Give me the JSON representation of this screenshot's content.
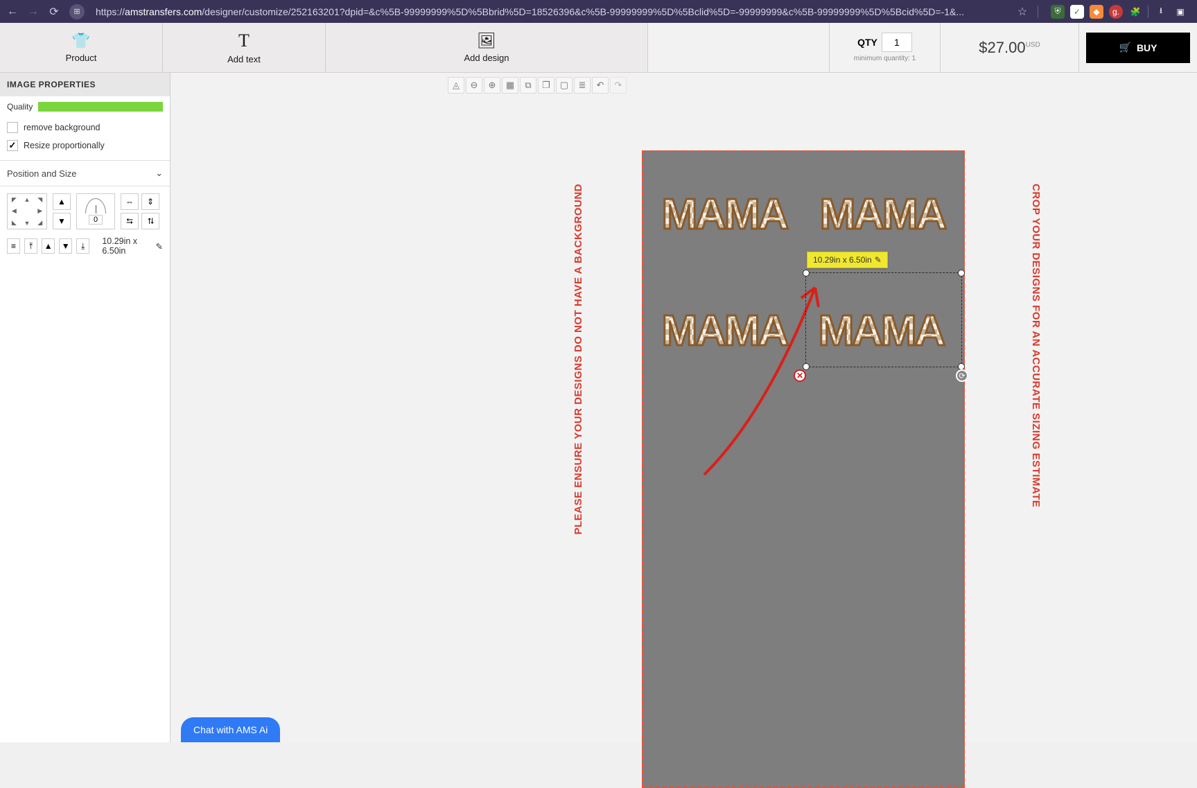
{
  "browser": {
    "url_prefix": "https://",
    "url_domain": "amstransfers.com",
    "url_path": "/designer/customize/252163201?dpid=&c%5B-99999999%5D%5Bbrid%5D=18526396&c%5B-99999999%5D%5Bclid%5D=-99999999&c%5B-99999999%5D%5Bcid%5D=-1&..."
  },
  "toolbar": {
    "product": "Product",
    "add_text": "Add text",
    "add_design": "Add design",
    "qty_label": "QTY",
    "qty_value": "1",
    "min_qty": "minimum quantity: 1",
    "price": "$27.00",
    "currency": "USD",
    "buy": "BUY"
  },
  "sidebar": {
    "title": "IMAGE PROPERTIES",
    "quality_label": "Quality",
    "remove_bg": "remove background",
    "resize_prop": "Resize proportionally",
    "pos_size": "Position and Size",
    "rotation": "0",
    "size_text": "10.29in x 6.50in"
  },
  "canvas": {
    "left_warning": "PLEASE ENSURE YOUR DESIGNS DO NOT HAVE A BACKGROUND",
    "right_warning": "CROP YOUR DESIGNS FOR AN ACCURATE SIZING ESTIMATE",
    "dim_badge": "10.29in x 6.50in",
    "design_text": "MAMA"
  },
  "chat": {
    "label": "Chat with AMS Ai"
  },
  "colors": {
    "accent_red": "#d93a2e",
    "quality_green": "#7bd63e",
    "badge_yellow": "#f0e82e",
    "buy_black": "#000000"
  }
}
